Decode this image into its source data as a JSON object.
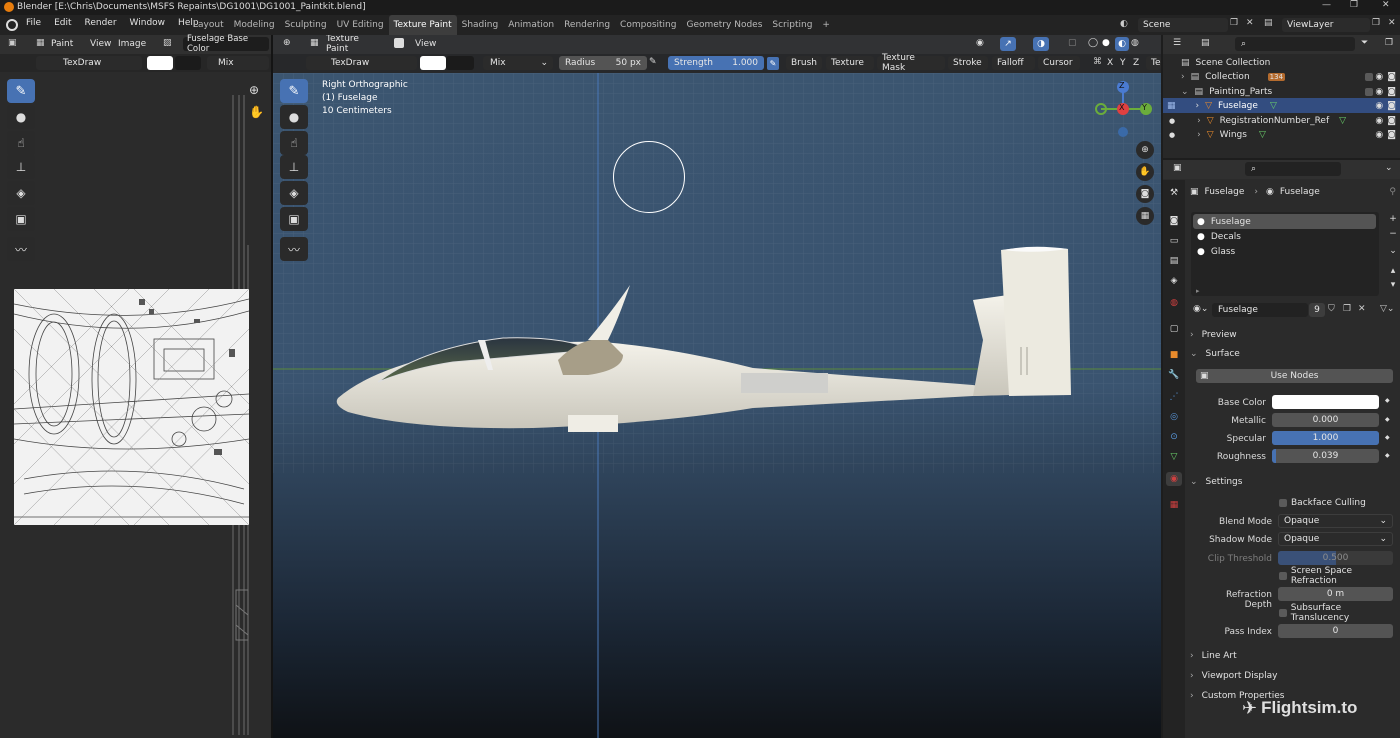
{
  "window": {
    "title": "Blender [E:\\Chris\\Documents\\MSFS Repaints\\DG1001\\DG1001_Paintkit.blend]"
  },
  "menu": [
    "File",
    "Edit",
    "Render",
    "Window",
    "Help"
  ],
  "workspaces": [
    "Layout",
    "Modeling",
    "Sculpting",
    "UV Editing",
    "Texture Paint",
    "Shading",
    "Animation",
    "Rendering",
    "Compositing",
    "Geometry Nodes",
    "Scripting"
  ],
  "scene": {
    "name": "Scene",
    "view_layer": "ViewLayer"
  },
  "image_editor": {
    "mode": "Paint",
    "view": "View",
    "image": "Image",
    "image_name": "Fuselage Base Color",
    "brush": "TexDraw",
    "blend": "Mix"
  },
  "viewport": {
    "mode": "Texture Paint",
    "view": "View",
    "brush": "TexDraw",
    "blend": "Mix",
    "radius_label": "Radius",
    "radius_value": "50 px",
    "strength_label": "Strength",
    "strength_value": "1.000",
    "strength_fraction": 1.0,
    "menus": [
      "Brush",
      "Texture",
      "Texture Mask",
      "Stroke",
      "Falloff",
      "Cursor"
    ],
    "axes": [
      "X",
      "Y",
      "Z"
    ],
    "overlay_line1": "Right Orthographic",
    "overlay_line2": "(1) Fuselage",
    "overlay_line3": "10 Centimeters",
    "gizmo": {
      "x": "X",
      "y": "Y",
      "z": "Z"
    }
  },
  "outliner": {
    "scene_collection": "Scene Collection",
    "items": [
      {
        "label": "Collection",
        "badge": "134"
      },
      {
        "label": "Painting_Parts"
      },
      {
        "label": "Fuselage"
      },
      {
        "label": "RegistrationNumber_Ref"
      },
      {
        "label": "Wings"
      }
    ]
  },
  "properties": {
    "breadcrumb_object": "Fuselage",
    "breadcrumb_material": "Fuselage",
    "slots": [
      "Fuselage",
      "Decals",
      "Glass"
    ],
    "material_name": "Fuselage",
    "users": "9",
    "preview": "Preview",
    "surface": "Surface",
    "use_nodes": "Use Nodes",
    "base_color_label": "Base Color",
    "base_color": "#ffffff",
    "metallic_label": "Metallic",
    "metallic": "0.000",
    "specular_label": "Specular",
    "specular": "1.000",
    "specular_fraction": 1.0,
    "roughness_label": "Roughness",
    "roughness": "0.039",
    "roughness_fraction": 0.039,
    "settings": "Settings",
    "backface": "Backface Culling",
    "blend_mode_label": "Blend Mode",
    "blend_mode": "Opaque",
    "shadow_mode_label": "Shadow Mode",
    "shadow_mode": "Opaque",
    "clip_label": "Clip Threshold",
    "clip": "0.500",
    "clip_fraction": 0.5,
    "ssr": "Screen Space Refraction",
    "refraction_label": "Refraction Depth",
    "refraction": "0 m",
    "subsurface": "Subsurface Translucency",
    "pass_label": "Pass Index",
    "pass": "0",
    "line_art": "Line Art",
    "viewport_display": "Viewport Display",
    "custom_props": "Custom Properties"
  },
  "watermark": "Flightsim.to",
  "colors": {
    "accent": "#4772b3",
    "header": "#303030",
    "panel": "#2b2b2b",
    "selected": "#334d80"
  }
}
